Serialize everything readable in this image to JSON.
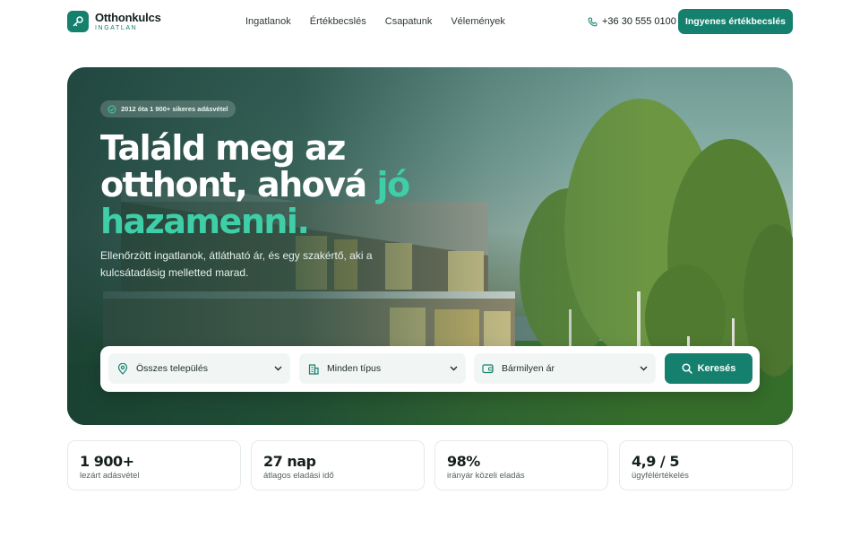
{
  "brand": {
    "name": "Otthonkulcs",
    "subtitle": "INGATLAN"
  },
  "nav": {
    "items": [
      "Ingatlanok",
      "Értékbecslés",
      "Csapatunk",
      "Vélemények"
    ]
  },
  "header": {
    "phone": "+36 30 555 0100",
    "cta_label": "Ingyenes értékbecslés"
  },
  "hero": {
    "badge": "2012 óta 1 900+ sikeres adásvétel",
    "title_line1": "Találd meg az",
    "title_line2_a": "otthont, ahová ",
    "title_line2_b": "jó",
    "title_line3": "hazamenni.",
    "lead": "Ellenőrzött ingatlanok, átlátható ár, és egy szakértő, aki a kulcsátadásig melletted marad."
  },
  "search": {
    "location": "Összes település",
    "type": "Minden típus",
    "price": "Bármilyen ár",
    "button_label": "Keresés"
  },
  "stats": [
    {
      "value": "1 900+",
      "label": "lezárt adásvétel"
    },
    {
      "value": "27 nap",
      "label": "átlagos eladási idő"
    },
    {
      "value": "98%",
      "label": "irányár közeli eladás"
    },
    {
      "value": "4,9 / 5",
      "label": "ügyfélértékelés"
    }
  ],
  "colors": {
    "brand": "#15806e",
    "accent": "#3ecfa8",
    "text": "#14201d"
  }
}
